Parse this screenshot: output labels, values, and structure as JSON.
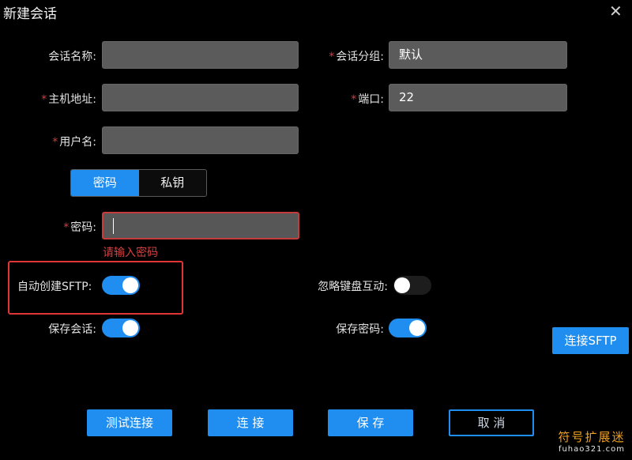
{
  "dialog": {
    "title": "新建会话"
  },
  "fields": {
    "session_name": {
      "label": "会话名称:",
      "value": ""
    },
    "session_group": {
      "label": "会话分组:",
      "value": "默认"
    },
    "host": {
      "label": "主机地址:",
      "value": ""
    },
    "port": {
      "label": "端口:",
      "value": "22"
    },
    "username": {
      "label": "用户名:",
      "value": ""
    },
    "password": {
      "label": "密码:",
      "value": "",
      "error": "请输入密码"
    }
  },
  "auth_tabs": {
    "password": "密码",
    "private_key": "私钥",
    "active": "password"
  },
  "toggles": {
    "auto_sftp": {
      "label": "自动创建SFTP:",
      "on": true
    },
    "ignore_keyboard": {
      "label": "忽略键盘互动:",
      "on": false
    },
    "save_session": {
      "label": "保存会话:",
      "on": true
    },
    "save_password": {
      "label": "保存密码:",
      "on": true
    }
  },
  "buttons": {
    "connect_sftp": "连接SFTP",
    "test": "测试连接",
    "connect": "连 接",
    "save": "保 存",
    "cancel": "取 消"
  },
  "watermark": {
    "line1": "符号扩展迷",
    "line2": "fuhao321.com"
  },
  "colors": {
    "accent": "#1f8ef0",
    "error": "#d14040",
    "required": "#d43c3c"
  }
}
